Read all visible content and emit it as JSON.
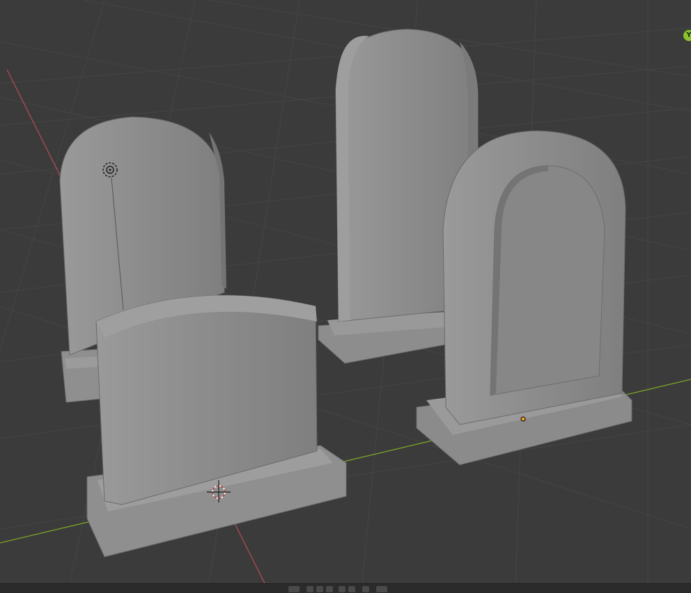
{
  "app": "3D viewport",
  "viewport": {
    "background": "#3b3b3b",
    "grid_color": "#474747",
    "x_axis_color": "#b04a55",
    "y_axis_color": "#7ca528",
    "object_color": "#8a8a8a",
    "objects": [
      "tombstone-round-top",
      "tombstone-tall",
      "tombstone-framed-arch",
      "tombstone-curved-top"
    ]
  },
  "gizmo": {
    "y_label": "Y",
    "y_color": "#8bc22d"
  },
  "bottom_bar": {
    "buttons": [
      "view-toggle",
      "mode-a",
      "mode-b",
      "mode-c",
      "mode-d",
      "mode-e",
      "mode-f"
    ]
  }
}
